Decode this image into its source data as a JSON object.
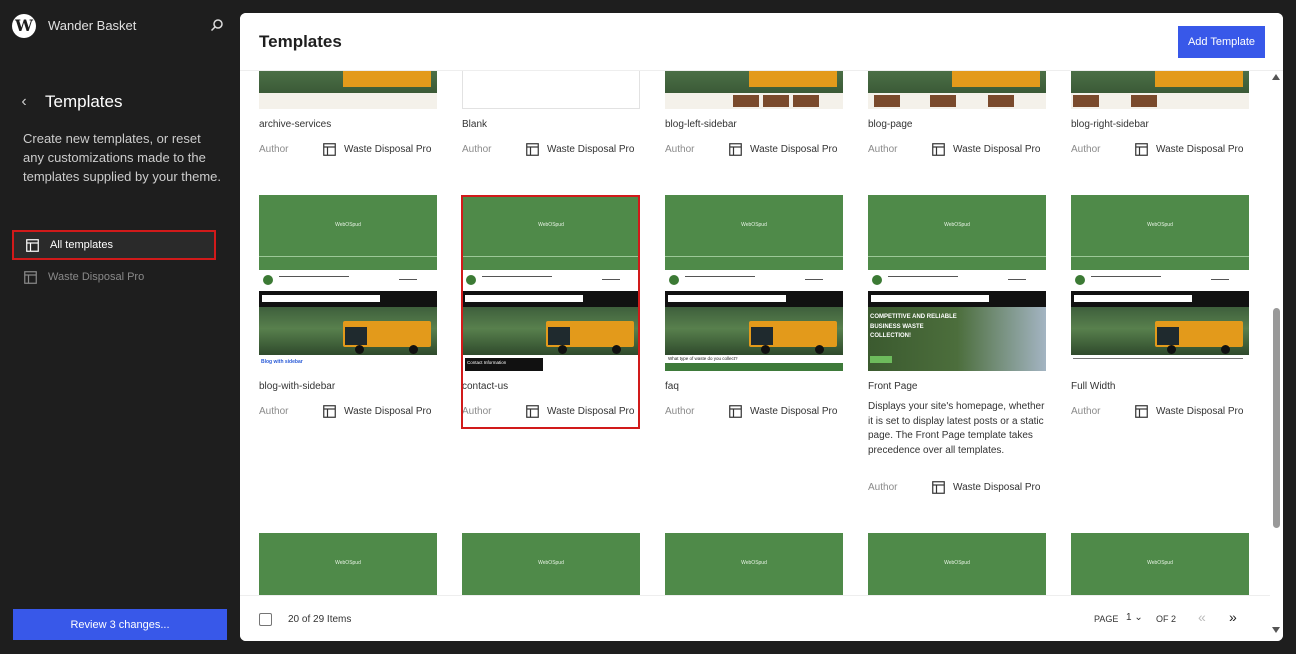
{
  "site": {
    "name": "Wander Basket"
  },
  "sidebar": {
    "title": "Templates",
    "description": "Create new templates, or reset any customizations made to the templates supplied by your theme.",
    "items": [
      {
        "label": "All templates"
      },
      {
        "label": "Waste Disposal Pro"
      }
    ],
    "review_label": "Review 3 changes..."
  },
  "main": {
    "title": "Templates",
    "add_label": "Add Template"
  },
  "thumb_logo": "WebOSpud",
  "templates_row1": [
    {
      "title": "archive-services",
      "author": "Author",
      "theme": "Waste Disposal Pro"
    },
    {
      "title": "Blank",
      "author": "Author",
      "theme": "Waste Disposal Pro"
    },
    {
      "title": "blog-left-sidebar",
      "author": "Author",
      "theme": "Waste Disposal Pro"
    },
    {
      "title": "blog-page",
      "author": "Author",
      "theme": "Waste Disposal Pro"
    },
    {
      "title": "blog-right-sidebar",
      "author": "Author",
      "theme": "Waste Disposal Pro"
    }
  ],
  "templates_row2": [
    {
      "title": "blog-with-sidebar",
      "author": "Author",
      "theme": "Waste Disposal Pro",
      "thumb_caption": "Blog with sidebar"
    },
    {
      "title": "contact-us",
      "author": "Author",
      "theme": "Waste Disposal Pro",
      "thumb_caption": "Contact Information"
    },
    {
      "title": "faq",
      "author": "Author",
      "theme": "Waste Disposal Pro",
      "thumb_caption": "What type of waste do you collect?"
    },
    {
      "title": "Front Page",
      "author": "Author",
      "theme": "Waste Disposal Pro",
      "description": "Displays your site's homepage, whether it is set to display latest posts or a static page. The Front Page template takes precedence over all templates.",
      "thumb_caption": "COMPETITIVE AND RELIABLE BUSINESS WASTE COLLECTION!"
    },
    {
      "title": "Full Width",
      "author": "Author",
      "theme": "Waste Disposal Pro"
    }
  ],
  "footer": {
    "items_label": "20 of 29 Items",
    "page_label": "PAGE",
    "page_value": "1",
    "of_label": "OF 2"
  },
  "colors": {
    "accent": "#3858e9",
    "thumb_green": "#4f8a49",
    "highlight": "#d11a1a"
  }
}
